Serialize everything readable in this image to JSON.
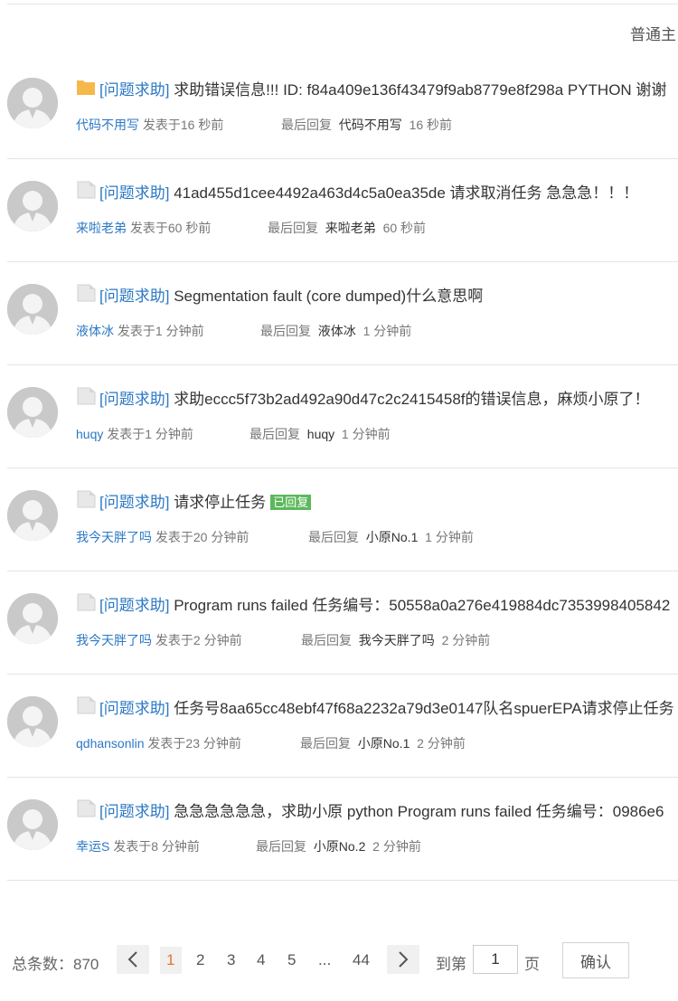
{
  "header": {
    "mode_label": "普通主"
  },
  "posts": [
    {
      "icon": "folder-icon",
      "tag": "[问题求助]",
      "title": "求助错误信息!!! ID: f84a409e136f43479f9ab8779e8f298a PYTHON 谢谢",
      "badge": "",
      "author": "代码不用写",
      "posted": "发表于16 秒前",
      "last_reply_label": "最后回复",
      "last_reply_user": "代码不用写",
      "last_reply_time": "16 秒前"
    },
    {
      "icon": "doc-icon",
      "tag": "[问题求助]",
      "title": "41ad455d1cee4492a463d4c5a0ea35de 请求取消任务 急急急！！！",
      "badge": "",
      "author": "来啦老弟",
      "posted": "发表于60 秒前",
      "last_reply_label": "最后回复",
      "last_reply_user": "来啦老弟",
      "last_reply_time": "60 秒前"
    },
    {
      "icon": "doc-icon",
      "tag": "[问题求助]",
      "title": "Segmentation fault (core dumped)什么意思啊",
      "badge": "",
      "author": "液体冰",
      "posted": "发表于1 分钟前",
      "last_reply_label": "最后回复",
      "last_reply_user": "液体冰",
      "last_reply_time": "1 分钟前"
    },
    {
      "icon": "doc-icon",
      "tag": "[问题求助]",
      "title": "求助eccc5f73b2ad492a90d47c2c2415458f的错误信息，麻烦小原了！",
      "badge": "",
      "author": "huqy",
      "posted": "发表于1 分钟前",
      "last_reply_label": "最后回复",
      "last_reply_user": "huqy",
      "last_reply_time": "1 分钟前"
    },
    {
      "icon": "doc-icon",
      "tag": "[问题求助]",
      "title": "请求停止任务",
      "badge": "已回复",
      "author": "我今天胖了吗",
      "posted": "发表于20 分钟前",
      "last_reply_label": "最后回复",
      "last_reply_user": "小原No.1",
      "last_reply_time": "1 分钟前"
    },
    {
      "icon": "doc-icon",
      "tag": "[问题求助]",
      "title": "Program runs failed 任务编号：50558a0a276e419884dc7353998405842",
      "badge": "",
      "author": "我今天胖了吗",
      "posted": "发表于2 分钟前",
      "last_reply_label": "最后回复",
      "last_reply_user": "我今天胖了吗",
      "last_reply_time": "2 分钟前"
    },
    {
      "icon": "doc-icon",
      "tag": "[问题求助]",
      "title": "任务号8aa65cc48ebf47f68a2232a79d3e0147队名spuerEPA请求停止任务",
      "badge": "",
      "author": "qdhansonlin",
      "posted": "发表于23 分钟前",
      "last_reply_label": "最后回复",
      "last_reply_user": "小原No.1",
      "last_reply_time": "2 分钟前"
    },
    {
      "icon": "doc-icon",
      "tag": "[问题求助]",
      "title": "急急急急急急，求助小原 python Program runs failed 任务编号：0986e6",
      "badge": "",
      "author": "幸运S",
      "posted": "发表于8 分钟前",
      "last_reply_label": "最后回复",
      "last_reply_user": "小原No.2",
      "last_reply_time": "2 分钟前"
    }
  ],
  "pagination": {
    "total_label": "总条数：870",
    "prev_icon": "chevron-left-icon",
    "next_icon": "chevron-right-icon",
    "pages": [
      "1",
      "2",
      "3",
      "4",
      "5",
      "...",
      "44"
    ],
    "current_page": "1",
    "goto_label": "到第",
    "goto_value": "1",
    "page_suffix": "页",
    "confirm_label": "确认"
  },
  "colors": {
    "link": "#2b78c5",
    "badge": "#5cb85c",
    "active_page": "#e8742e",
    "folder": "#f7b84b"
  }
}
